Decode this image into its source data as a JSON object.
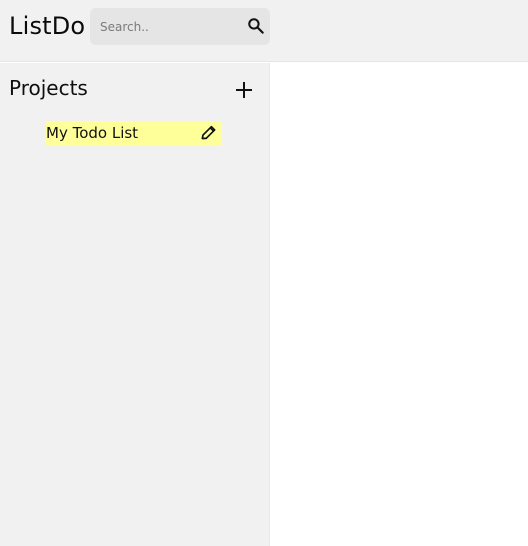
{
  "app": {
    "title": "ListDo"
  },
  "search": {
    "placeholder": "Search.."
  },
  "sidebar": {
    "heading": "Projects",
    "items": [
      {
        "label": "My Todo List"
      }
    ]
  },
  "icons": {
    "search": "search-icon",
    "add": "plus-icon",
    "edit": "pencil-icon"
  },
  "colors": {
    "header_bg": "#f1f1f1",
    "sidebar_bg": "#f1f1f1",
    "search_bg": "#e5e5e5",
    "highlight": "#ffff9a",
    "content_bg": "#ffffff"
  }
}
